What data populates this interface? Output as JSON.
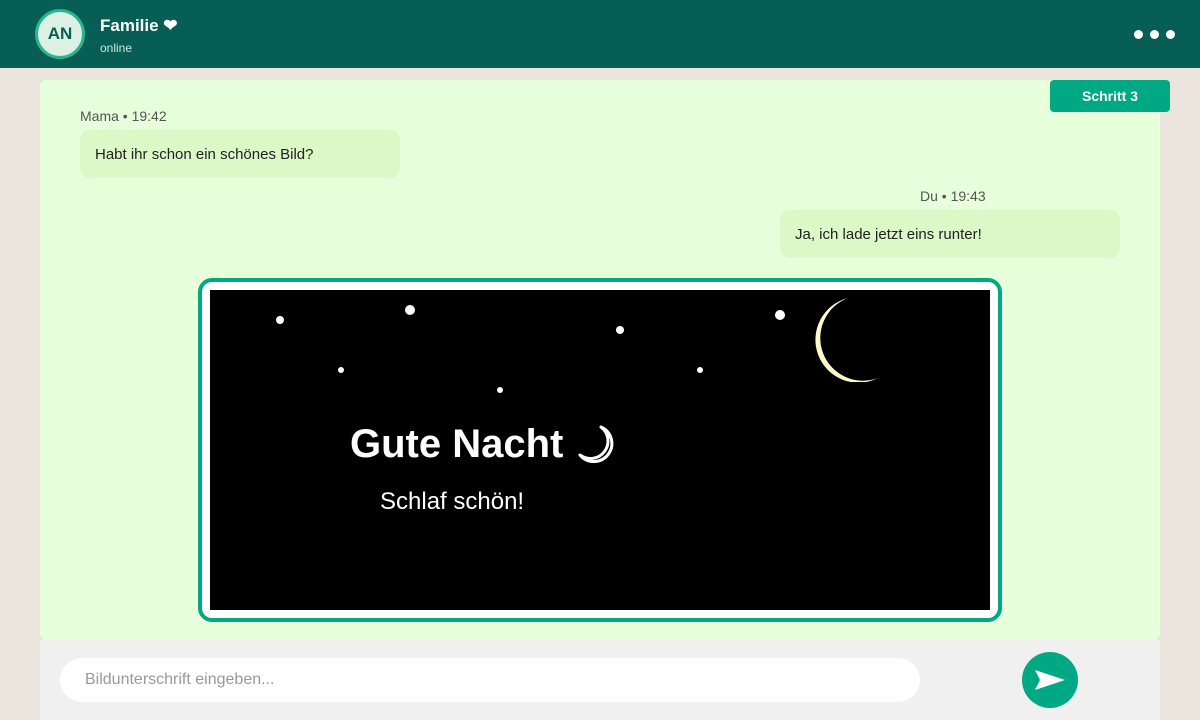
{
  "header": {
    "avatar_initials": "AN",
    "chat_name": "Familie ❤",
    "status": "online",
    "menu_icon": "more-dots-icon"
  },
  "step_badge": "Schritt 3",
  "messages": [
    {
      "sender_time": "Mama • 19:42",
      "text": "Habt ihr schon ein schönes Bild?",
      "direction": "incoming"
    },
    {
      "sender_time": "Du • 19:43",
      "text": "Ja, ich lade jetzt eins runter!",
      "direction": "outgoing"
    }
  ],
  "image": {
    "greeting": "Gute Nacht",
    "greeting_icon": "crescent-moon-icon",
    "subtext": "Schlaf schön!"
  },
  "composer": {
    "placeholder": "Bildunterschrift eingeben...",
    "send_icon": "send-icon"
  },
  "colors": {
    "header": "#075e54",
    "accent": "#00a884",
    "chat_background": "#e7ffdb",
    "bubble": "#dcf8c6",
    "moon": "#fffacd"
  }
}
